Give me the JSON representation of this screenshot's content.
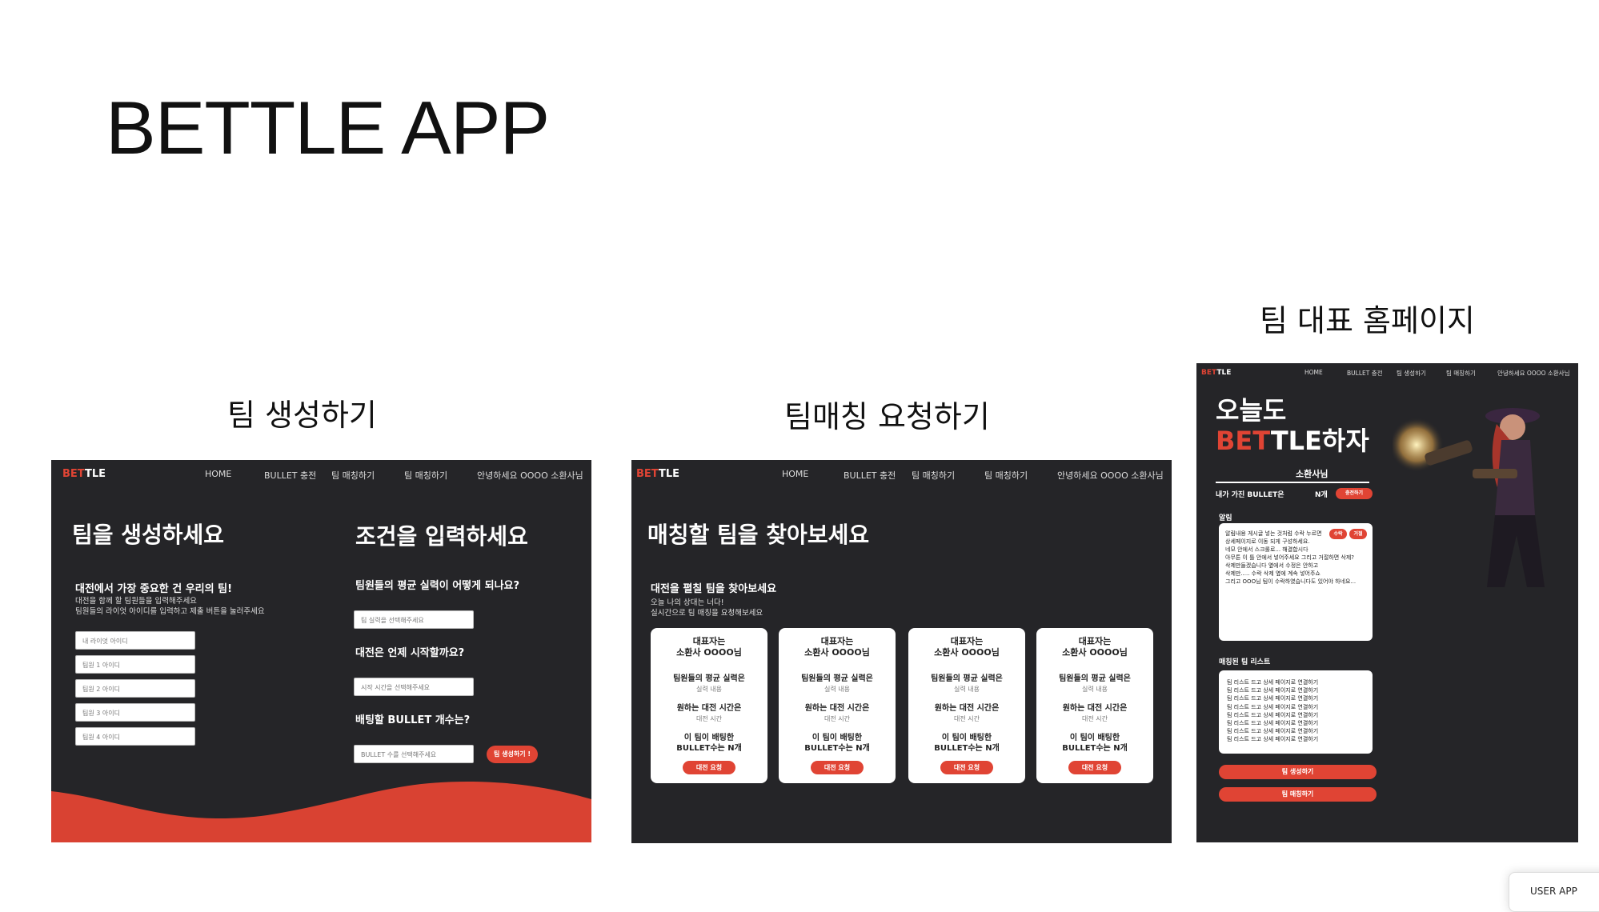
{
  "main_title": "BETTLE APP",
  "sections": {
    "team_create": "팀 생성하기",
    "team_match": "팀매칭 요청하기",
    "team_home": "팀 대표 홈페이지"
  },
  "nav": {
    "logo_red": "BET",
    "logo_white": "TLE",
    "home": "HOME",
    "bullet": "BULLET 충전",
    "team_create": "팀 매칭하기",
    "team_match": "팀 매칭하기",
    "greeting": "안녕하세요 OOOO 소환사님"
  },
  "panel1": {
    "left_title": "팀을 생성하세요",
    "left_subtitle": "대전에서 가장 중요한 건 우리의 팀!",
    "left_desc1": "대전을 함께 할 팀원들을 입력해주세요",
    "left_desc2": "팀원들의 라이엇 아이디를 입력하고 제출 버튼을 눌러주세요",
    "inputs": [
      "내 라이엇 아이디",
      "팀원 1 아이디",
      "팀원 2 아이디",
      "팀원 3 아이디",
      "팀원 4 아이디"
    ],
    "right_title": "조건을 입력하세요",
    "q1": "팀원들의 평균 실력이 어떻게 되나요?",
    "q1_placeholder": "팀 실력을 선택해주세요",
    "q2": "대전은 언제 시작할까요?",
    "q2_placeholder": "시작 시간을 선택해주세요",
    "q3": "배팅할 BULLET 개수는?",
    "q3_placeholder": "BULLET 수를 선택해주세요",
    "submit": "팀 생성하기 !"
  },
  "panel2": {
    "title": "매칭할 팀을 찾아보세요",
    "subtitle": "대전을 펼칠 팀을 찾아보세요",
    "desc1": "오늘 나의 상대는 너다!",
    "desc2": "실시간으로 팀 매칭을 요청해보세요",
    "cards": [
      {
        "name1": "대표자는",
        "name2": "소환사 OOOO님",
        "l1": "팀원들의 평균 실력은",
        "v1": "실력 내용",
        "l2": "원하는 대전 시간은",
        "v2": "대전 시간",
        "l3a": "이 팀이 배팅한",
        "l3b": "BULLET수는 N개",
        "btn": "대전 요청"
      },
      {
        "name1": "대표자는",
        "name2": "소환사 OOOO님",
        "l1": "팀원들의 평균 실력은",
        "v1": "실력 내용",
        "l2": "원하는 대전 시간은",
        "v2": "대전 시간",
        "l3a": "이 팀이 배팅한",
        "l3b": "BULLET수는 N개",
        "btn": "대전 요청"
      },
      {
        "name1": "대표자는",
        "name2": "소환사 OOOO님",
        "l1": "팀원들의 평균 실력은",
        "v1": "실력 내용",
        "l2": "원하는 대전 시간은",
        "v2": "대전 시간",
        "l3a": "이 팀이 배팅한",
        "l3b": "BULLET수는 N개",
        "btn": "대전 요청"
      },
      {
        "name1": "대표자는",
        "name2": "소환사 OOOO님",
        "l1": "팀원들의 평균 실력은",
        "v1": "실력 내용",
        "l2": "원하는 대전 시간은",
        "v2": "대전 시간",
        "l3a": "이 팀이 배팅한",
        "l3b": "BULLET수는 N개",
        "btn": "대전 요청"
      }
    ]
  },
  "panel3": {
    "nav_bullet": "BULLET 충전",
    "nav_create": "팀 생성하기",
    "nav_match": "팀 매칭하기",
    "nav_greeting": "안녕하세요 OOOO 소환사님",
    "hero1": "오늘도",
    "hero2_red": "BET",
    "hero2_white": "TLE하자",
    "user": "소환사님",
    "bullet_label": "내가 가진 BULLET은",
    "bullet_value": "N개",
    "charge": "충전하기",
    "notice_label": "알림",
    "notice_lines": [
      "알림내용 게시글 넣는 것처럼 수락 누르면",
      "상세페이지로 이동 되게 구성하세요.",
      "네모 안에서 스크롤로... 해결합시다",
      "아무튼 이 틀 안에서 넣어주세요 그리고 거절하면 삭제?",
      "삭제만들겠습니다 옆에서 수정은 안하고",
      "삭제만..... 수락 삭제 옆에 계속 넣어주쇼",
      "그리고 OOO님 팀이 수락하였습니다도 있어야 하네요..."
    ],
    "accept": "수락",
    "reject": "거절",
    "list_label": "매칭된 팀 리스트",
    "list_item": "팀 리스트 드고 상세 페이지로 연결하기",
    "btn_create": "팀 생성하기",
    "btn_match": "팀 매칭하기"
  },
  "corner_label": "USER APP"
}
